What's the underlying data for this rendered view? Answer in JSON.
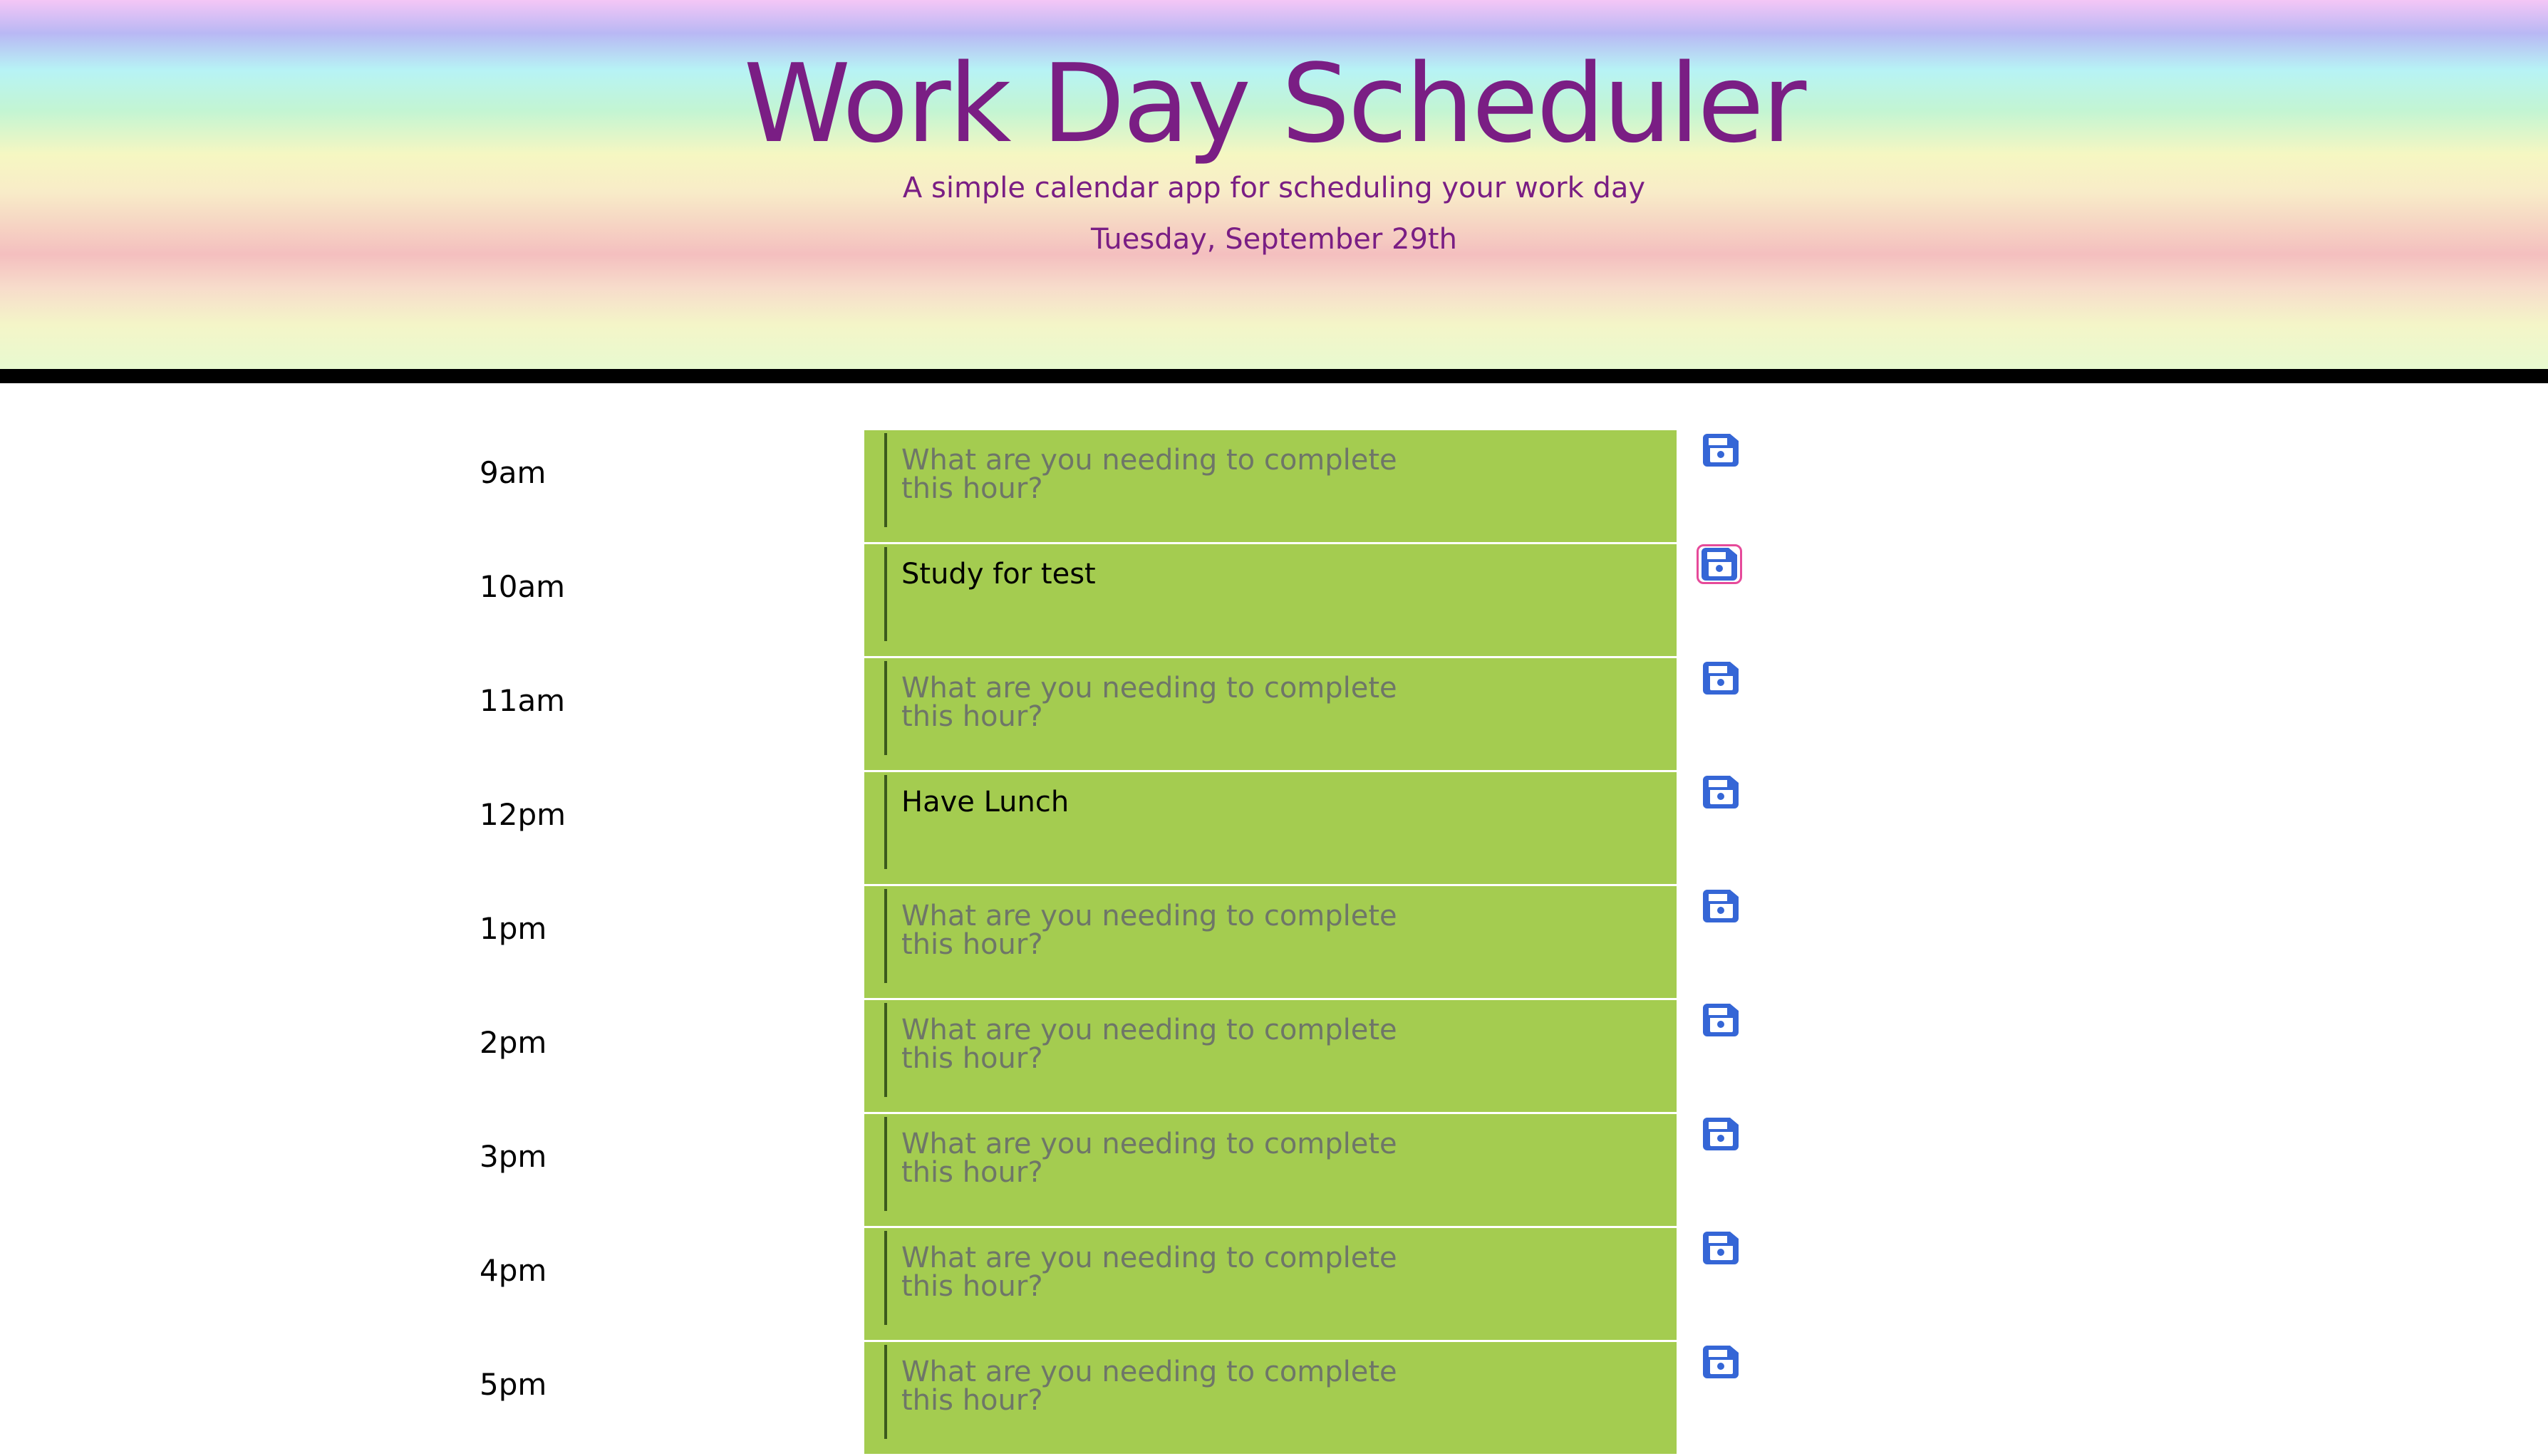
{
  "header": {
    "title": "Work Day Scheduler",
    "subtitle": "A simple calendar app for scheduling your work day",
    "current_day": "Tuesday, September 29th"
  },
  "textarea_placeholder": "What are you needing to complete this hour?",
  "colors": {
    "title_purple": "#7a1e84",
    "present_green": "#a4cc50",
    "save_icon_blue": "#3566d6",
    "focus_pink": "#e64a9a"
  },
  "save_icon": "save-icon",
  "hours": [
    {
      "label": "9am",
      "value": ""
    },
    {
      "label": "10am",
      "value": "Study for test",
      "focused_save": true
    },
    {
      "label": "11am",
      "value": ""
    },
    {
      "label": "12pm",
      "value": "Have Lunch"
    },
    {
      "label": "1pm",
      "value": ""
    },
    {
      "label": "2pm",
      "value": ""
    },
    {
      "label": "3pm",
      "value": ""
    },
    {
      "label": "4pm",
      "value": ""
    },
    {
      "label": "5pm",
      "value": ""
    }
  ]
}
